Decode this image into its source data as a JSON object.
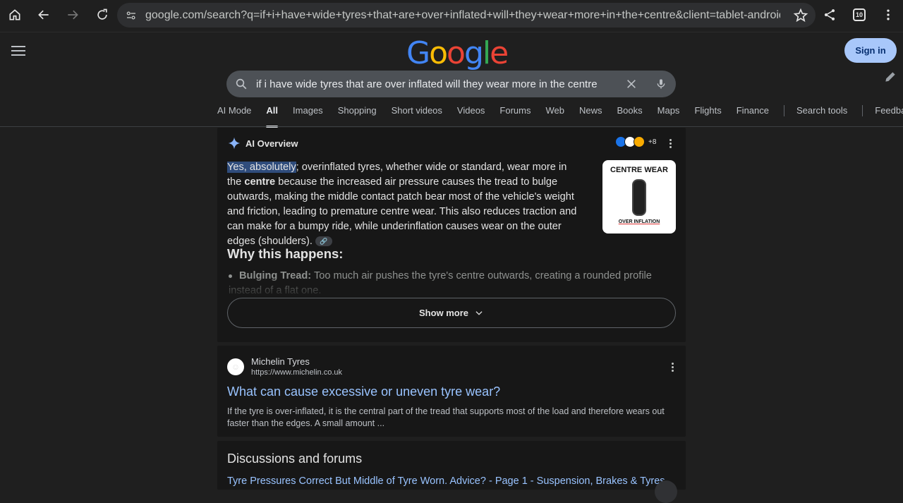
{
  "browser": {
    "url": "google.com/search?q=if+i+have+wide+tyres+that+are+over+inflated+will+they+wear+more+in+the+centre&client=tablet-android-samsung-ss&",
    "tab_count": "10"
  },
  "header": {
    "logo_text": "Google",
    "sign_in_label": "Sign in"
  },
  "search": {
    "query": "if i have wide tyres that are over inflated will they wear more in the centre"
  },
  "tabs": [
    "AI Mode",
    "All",
    "Images",
    "Shopping",
    "Short videos",
    "Videos",
    "Forums",
    "Web",
    "News",
    "Books",
    "Maps",
    "Flights",
    "Finance"
  ],
  "active_tab": "All",
  "tools": {
    "search_tools": "Search tools",
    "feedback": "Feedback"
  },
  "ai_overview": {
    "label": "AI Overview",
    "sources_more": "+8",
    "highlight": "Yes, absolutely",
    "text_1": "; overinflated tyres, whether wide or standard, wear more in the",
    "bold_word": "centre",
    "text_2": "because the increased air pressure causes the tread to bulge outwards, making the middle contact patch bear most of the vehicle's weight and friction, leading to premature centre wear. This also reduces traction and can make for a bumpy ride, while underinflation causes wear on the outer edges (shoulders).",
    "thumb_title": "CENTRE WEAR",
    "thumb_caption": "OVER INFLATION",
    "why_heading": "Why this happens:",
    "bullet_bold": "Bulging Tread:",
    "bullet_text": "Too much air pushes the tyre's centre outwards, creating a rounded profile instead of a flat one.",
    "show_more": "Show more"
  },
  "result": {
    "site_name": "Michelin Tyres",
    "site_url": "https://www.michelin.co.uk",
    "title": "What can cause excessive or uneven tyre wear?",
    "snippet": "If the tyre is over-inflated, it is the central part of the tread that supports most of the load and therefore wears out faster than the edges. A small amount ..."
  },
  "discussions": {
    "heading": "Discussions and forums",
    "first_link": "Tyre Pressures Correct But Middle of Tyre Worn. Advice? - Page 1 - Suspension, Brakes & Tyres"
  },
  "colors": {
    "accent_link": "#99c3ff",
    "sign_in_bg": "#a8c7fa",
    "highlight_bg": "#2f4c7c"
  }
}
